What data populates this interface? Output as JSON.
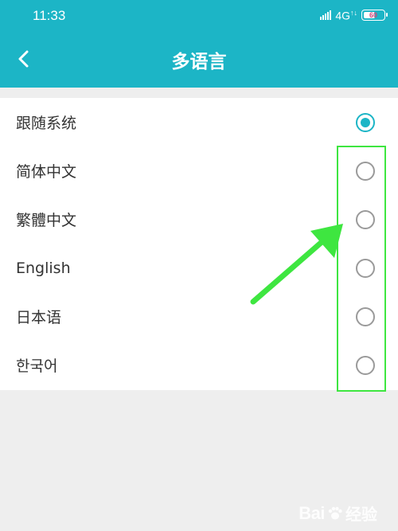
{
  "status_bar": {
    "time": "11:33",
    "network": "4G",
    "network_arrows": "↑↓",
    "battery_level_percent": 60,
    "battery_text": "60"
  },
  "header": {
    "title": "多语言",
    "back_icon": "chevron-left-icon"
  },
  "languages": [
    {
      "label": "跟随系统",
      "selected": true
    },
    {
      "label": "简体中文",
      "selected": false
    },
    {
      "label": "繁體中文",
      "selected": false
    },
    {
      "label": "English",
      "selected": false
    },
    {
      "label": "日本语",
      "selected": false
    },
    {
      "label": "한국어",
      "selected": false
    }
  ],
  "annotation": {
    "color": "#3ee640"
  },
  "watermark": {
    "brand": "Bai",
    "brand_suffix": "经验"
  },
  "colors": {
    "accent": "#1cb5c6",
    "background": "#eeeeee",
    "radio_unchecked": "#9a9a9a"
  }
}
